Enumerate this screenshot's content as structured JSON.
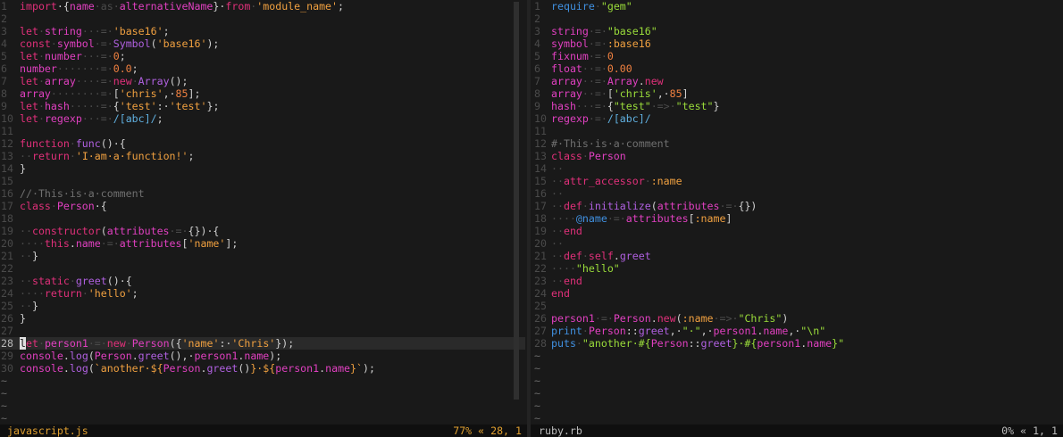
{
  "left_file": {
    "name": "javascript.js",
    "status": "77% « 28, 1",
    "current_line": 28,
    "lines": [
      [
        {
          "t": "import",
          "c": "kw"
        },
        {
          "t": "·{",
          "c": "op"
        },
        {
          "t": "name",
          "c": "id"
        },
        {
          "t": "·as·",
          "c": "ws"
        },
        {
          "t": "alternativeName",
          "c": "id"
        },
        {
          "t": "}·",
          "c": "op"
        },
        {
          "t": "from",
          "c": "kw"
        },
        {
          "t": "·",
          "c": "ws"
        },
        {
          "t": "'module_name'",
          "c": "str"
        },
        {
          "t": ";",
          "c": "op"
        }
      ],
      [],
      [
        {
          "t": "let",
          "c": "kw"
        },
        {
          "t": "·",
          "c": "ws"
        },
        {
          "t": "string",
          "c": "id"
        },
        {
          "t": "···=·",
          "c": "ws"
        },
        {
          "t": "'base16'",
          "c": "str"
        },
        {
          "t": ";",
          "c": "op"
        }
      ],
      [
        {
          "t": "const",
          "c": "kw"
        },
        {
          "t": "·",
          "c": "ws"
        },
        {
          "t": "symbol",
          "c": "id"
        },
        {
          "t": "·=·",
          "c": "ws"
        },
        {
          "t": "Symbol",
          "c": "fn"
        },
        {
          "t": "(",
          "c": "op"
        },
        {
          "t": "'base16'",
          "c": "str"
        },
        {
          "t": ");",
          "c": "op"
        }
      ],
      [
        {
          "t": "let",
          "c": "kw"
        },
        {
          "t": "·",
          "c": "ws"
        },
        {
          "t": "number",
          "c": "id"
        },
        {
          "t": "···=·",
          "c": "ws"
        },
        {
          "t": "0",
          "c": "num"
        },
        {
          "t": ";",
          "c": "op"
        }
      ],
      [
        {
          "t": "number",
          "c": "id"
        },
        {
          "t": "·······=·",
          "c": "ws"
        },
        {
          "t": "0.0",
          "c": "num"
        },
        {
          "t": ";",
          "c": "op"
        }
      ],
      [
        {
          "t": "let",
          "c": "kw"
        },
        {
          "t": "·",
          "c": "ws"
        },
        {
          "t": "array",
          "c": "id"
        },
        {
          "t": "····=·",
          "c": "ws"
        },
        {
          "t": "new",
          "c": "kw"
        },
        {
          "t": "·",
          "c": "ws"
        },
        {
          "t": "Array",
          "c": "fn"
        },
        {
          "t": "();",
          "c": "op"
        }
      ],
      [
        {
          "t": "array",
          "c": "id"
        },
        {
          "t": "········=·",
          "c": "ws"
        },
        {
          "t": "[",
          "c": "op"
        },
        {
          "t": "'chris'",
          "c": "str"
        },
        {
          "t": ",·",
          "c": "op"
        },
        {
          "t": "85",
          "c": "num"
        },
        {
          "t": "];",
          "c": "op"
        }
      ],
      [
        {
          "t": "let",
          "c": "kw"
        },
        {
          "t": "·",
          "c": "ws"
        },
        {
          "t": "hash",
          "c": "id"
        },
        {
          "t": "·····=·",
          "c": "ws"
        },
        {
          "t": "{",
          "c": "op"
        },
        {
          "t": "'test'",
          "c": "str"
        },
        {
          "t": ":·",
          "c": "op"
        },
        {
          "t": "'test'",
          "c": "str"
        },
        {
          "t": "};",
          "c": "op"
        }
      ],
      [
        {
          "t": "let",
          "c": "kw"
        },
        {
          "t": "·",
          "c": "ws"
        },
        {
          "t": "regexp",
          "c": "id"
        },
        {
          "t": "···=·",
          "c": "ws"
        },
        {
          "t": "/[abc]/",
          "c": "rre"
        },
        {
          "t": ";",
          "c": "op"
        }
      ],
      [],
      [
        {
          "t": "function",
          "c": "kw"
        },
        {
          "t": "·",
          "c": "ws"
        },
        {
          "t": "func",
          "c": "fn"
        },
        {
          "t": "()·{",
          "c": "op"
        }
      ],
      [
        {
          "t": "··",
          "c": "ws"
        },
        {
          "t": "return",
          "c": "kw"
        },
        {
          "t": "·",
          "c": "ws"
        },
        {
          "t": "'I·am·a·function!'",
          "c": "str"
        },
        {
          "t": ";",
          "c": "op"
        }
      ],
      [
        {
          "t": "}",
          "c": "op"
        }
      ],
      [],
      [
        {
          "t": "//·This·is·a·comment",
          "c": "cmt"
        }
      ],
      [
        {
          "t": "class",
          "c": "kw"
        },
        {
          "t": "·",
          "c": "ws"
        },
        {
          "t": "Person",
          "c": "cls"
        },
        {
          "t": "·{",
          "c": "op"
        }
      ],
      [],
      [
        {
          "t": "··",
          "c": "ws"
        },
        {
          "t": "constructor",
          "c": "kw"
        },
        {
          "t": "(",
          "c": "op"
        },
        {
          "t": "attributes",
          "c": "id"
        },
        {
          "t": "·=·",
          "c": "ws"
        },
        {
          "t": "{})·{",
          "c": "op"
        }
      ],
      [
        {
          "t": "····",
          "c": "ws"
        },
        {
          "t": "this",
          "c": "kw"
        },
        {
          "t": ".",
          "c": "op"
        },
        {
          "t": "name",
          "c": "id"
        },
        {
          "t": "·=·",
          "c": "ws"
        },
        {
          "t": "attributes",
          "c": "id"
        },
        {
          "t": "[",
          "c": "op"
        },
        {
          "t": "'name'",
          "c": "str"
        },
        {
          "t": "];",
          "c": "op"
        }
      ],
      [
        {
          "t": "··",
          "c": "ws"
        },
        {
          "t": "}",
          "c": "op"
        }
      ],
      [],
      [
        {
          "t": "··",
          "c": "ws"
        },
        {
          "t": "static",
          "c": "kw"
        },
        {
          "t": "·",
          "c": "ws"
        },
        {
          "t": "greet",
          "c": "fn"
        },
        {
          "t": "()·{",
          "c": "op"
        }
      ],
      [
        {
          "t": "····",
          "c": "ws"
        },
        {
          "t": "return",
          "c": "kw"
        },
        {
          "t": "·",
          "c": "ws"
        },
        {
          "t": "'hello'",
          "c": "str"
        },
        {
          "t": ";",
          "c": "op"
        }
      ],
      [
        {
          "t": "··",
          "c": "ws"
        },
        {
          "t": "}",
          "c": "op"
        }
      ],
      [
        {
          "t": "}",
          "c": "op"
        }
      ],
      [],
      [
        {
          "t": "let",
          "c": "kw",
          "cursor": true
        },
        {
          "t": "·",
          "c": "ws"
        },
        {
          "t": "person1",
          "c": "id"
        },
        {
          "t": "·=·",
          "c": "ws"
        },
        {
          "t": "new",
          "c": "kw"
        },
        {
          "t": "·",
          "c": "ws"
        },
        {
          "t": "Person",
          "c": "cls"
        },
        {
          "t": "({",
          "c": "op"
        },
        {
          "t": "'name'",
          "c": "str"
        },
        {
          "t": ":·",
          "c": "op"
        },
        {
          "t": "'Chris'",
          "c": "str"
        },
        {
          "t": "});",
          "c": "op"
        }
      ],
      [
        {
          "t": "console",
          "c": "id"
        },
        {
          "t": ".",
          "c": "op"
        },
        {
          "t": "log",
          "c": "fn"
        },
        {
          "t": "(",
          "c": "op"
        },
        {
          "t": "Person",
          "c": "cls"
        },
        {
          "t": ".",
          "c": "op"
        },
        {
          "t": "greet",
          "c": "fn"
        },
        {
          "t": "(),·",
          "c": "op"
        },
        {
          "t": "person1",
          "c": "id"
        },
        {
          "t": ".",
          "c": "op"
        },
        {
          "t": "name",
          "c": "id"
        },
        {
          "t": ");",
          "c": "op"
        }
      ],
      [
        {
          "t": "console",
          "c": "id"
        },
        {
          "t": ".",
          "c": "op"
        },
        {
          "t": "log",
          "c": "fn"
        },
        {
          "t": "(",
          "c": "op"
        },
        {
          "t": "`another·${",
          "c": "str"
        },
        {
          "t": "Person",
          "c": "cls"
        },
        {
          "t": ".",
          "c": "op"
        },
        {
          "t": "greet",
          "c": "fn"
        },
        {
          "t": "()",
          "c": "op"
        },
        {
          "t": "}·${",
          "c": "str"
        },
        {
          "t": "person1",
          "c": "id"
        },
        {
          "t": ".",
          "c": "op"
        },
        {
          "t": "name",
          "c": "id"
        },
        {
          "t": "}`",
          "c": "str"
        },
        {
          "t": ");",
          "c": "op"
        }
      ]
    ],
    "tilde_count": 4
  },
  "right_file": {
    "name": "ruby.rb",
    "status": "0% « 1, 1",
    "lines": [
      [
        {
          "t": "require",
          "c": "blue"
        },
        {
          "t": "·",
          "c": "ws"
        },
        {
          "t": "\"gem\"",
          "c": "green"
        }
      ],
      [],
      [
        {
          "t": "string",
          "c": "id"
        },
        {
          "t": "·=·",
          "c": "ws"
        },
        {
          "t": "\"base16\"",
          "c": "green"
        }
      ],
      [
        {
          "t": "symbol",
          "c": "id"
        },
        {
          "t": "·=·",
          "c": "ws"
        },
        {
          "t": ":base16",
          "c": "sym"
        }
      ],
      [
        {
          "t": "fixnum",
          "c": "id"
        },
        {
          "t": "·=·",
          "c": "ws"
        },
        {
          "t": "0",
          "c": "num"
        }
      ],
      [
        {
          "t": "float",
          "c": "id"
        },
        {
          "t": "··=·",
          "c": "ws"
        },
        {
          "t": "0.00",
          "c": "num"
        }
      ],
      [
        {
          "t": "array",
          "c": "id"
        },
        {
          "t": "··=·",
          "c": "ws"
        },
        {
          "t": "Array",
          "c": "cls"
        },
        {
          "t": ".",
          "c": "op"
        },
        {
          "t": "new",
          "c": "kw"
        }
      ],
      [
        {
          "t": "array",
          "c": "id"
        },
        {
          "t": "··=·",
          "c": "ws"
        },
        {
          "t": "[",
          "c": "op"
        },
        {
          "t": "'chris'",
          "c": "green"
        },
        {
          "t": ",·",
          "c": "op"
        },
        {
          "t": "85",
          "c": "num"
        },
        {
          "t": "]",
          "c": "op"
        }
      ],
      [
        {
          "t": "hash",
          "c": "id"
        },
        {
          "t": "···=·",
          "c": "ws"
        },
        {
          "t": "{",
          "c": "op"
        },
        {
          "t": "\"test\"",
          "c": "green"
        },
        {
          "t": "·=>·",
          "c": "ws"
        },
        {
          "t": "\"test\"",
          "c": "green"
        },
        {
          "t": "}",
          "c": "op"
        }
      ],
      [
        {
          "t": "regexp",
          "c": "id"
        },
        {
          "t": "·=·",
          "c": "ws"
        },
        {
          "t": "/[abc]/",
          "c": "rre"
        }
      ],
      [],
      [
        {
          "t": "#·This·is·a·comment",
          "c": "cmt"
        }
      ],
      [
        {
          "t": "class",
          "c": "kw"
        },
        {
          "t": "·",
          "c": "ws"
        },
        {
          "t": "Person",
          "c": "cls"
        }
      ],
      [
        {
          "t": "··",
          "c": "ws"
        }
      ],
      [
        {
          "t": "··",
          "c": "ws"
        },
        {
          "t": "attr_accessor",
          "c": "kw"
        },
        {
          "t": "·",
          "c": "ws"
        },
        {
          "t": ":name",
          "c": "sym"
        }
      ],
      [
        {
          "t": "··",
          "c": "ws"
        }
      ],
      [
        {
          "t": "··",
          "c": "ws"
        },
        {
          "t": "def",
          "c": "kw"
        },
        {
          "t": "·",
          "c": "ws"
        },
        {
          "t": "initialize",
          "c": "fn"
        },
        {
          "t": "(",
          "c": "op"
        },
        {
          "t": "attributes",
          "c": "id"
        },
        {
          "t": "·=·",
          "c": "ws"
        },
        {
          "t": "{})",
          "c": "op"
        }
      ],
      [
        {
          "t": "····",
          "c": "ws"
        },
        {
          "t": "@name",
          "c": "blue"
        },
        {
          "t": "·=·",
          "c": "ws"
        },
        {
          "t": "attributes",
          "c": "id"
        },
        {
          "t": "[",
          "c": "op"
        },
        {
          "t": ":name",
          "c": "sym"
        },
        {
          "t": "]",
          "c": "op"
        }
      ],
      [
        {
          "t": "··",
          "c": "ws"
        },
        {
          "t": "end",
          "c": "kw"
        }
      ],
      [
        {
          "t": "··",
          "c": "ws"
        }
      ],
      [
        {
          "t": "··",
          "c": "ws"
        },
        {
          "t": "def",
          "c": "kw"
        },
        {
          "t": "·",
          "c": "ws"
        },
        {
          "t": "self",
          "c": "kw"
        },
        {
          "t": ".",
          "c": "op"
        },
        {
          "t": "greet",
          "c": "fn"
        }
      ],
      [
        {
          "t": "····",
          "c": "ws"
        },
        {
          "t": "\"hello\"",
          "c": "green"
        }
      ],
      [
        {
          "t": "··",
          "c": "ws"
        },
        {
          "t": "end",
          "c": "kw"
        }
      ],
      [
        {
          "t": "end",
          "c": "kw"
        }
      ],
      [],
      [
        {
          "t": "person1",
          "c": "id"
        },
        {
          "t": "·=·",
          "c": "ws"
        },
        {
          "t": "Person",
          "c": "cls"
        },
        {
          "t": ".",
          "c": "op"
        },
        {
          "t": "new",
          "c": "kw"
        },
        {
          "t": "(",
          "c": "op"
        },
        {
          "t": ":name",
          "c": "sym"
        },
        {
          "t": "·=>·",
          "c": "ws"
        },
        {
          "t": "\"Chris\"",
          "c": "green"
        },
        {
          "t": ")",
          "c": "op"
        }
      ],
      [
        {
          "t": "print",
          "c": "blue"
        },
        {
          "t": "·",
          "c": "ws"
        },
        {
          "t": "Person",
          "c": "cls"
        },
        {
          "t": "::",
          "c": "op"
        },
        {
          "t": "greet",
          "c": "fn"
        },
        {
          "t": ",·",
          "c": "op"
        },
        {
          "t": "\"·\"",
          "c": "green"
        },
        {
          "t": ",·",
          "c": "op"
        },
        {
          "t": "person1",
          "c": "id"
        },
        {
          "t": ".",
          "c": "op"
        },
        {
          "t": "name",
          "c": "id"
        },
        {
          "t": ",·",
          "c": "op"
        },
        {
          "t": "\"\\n\"",
          "c": "green"
        }
      ],
      [
        {
          "t": "puts",
          "c": "blue"
        },
        {
          "t": "·",
          "c": "ws"
        },
        {
          "t": "\"another·#{",
          "c": "green"
        },
        {
          "t": "Person",
          "c": "cls"
        },
        {
          "t": "::",
          "c": "op"
        },
        {
          "t": "greet",
          "c": "fn"
        },
        {
          "t": "}·#{",
          "c": "green"
        },
        {
          "t": "person1",
          "c": "id"
        },
        {
          "t": ".",
          "c": "op"
        },
        {
          "t": "name",
          "c": "id"
        },
        {
          "t": "}\"",
          "c": "green"
        }
      ]
    ],
    "tilde_count": 6
  },
  "tilde_glyph": "~"
}
